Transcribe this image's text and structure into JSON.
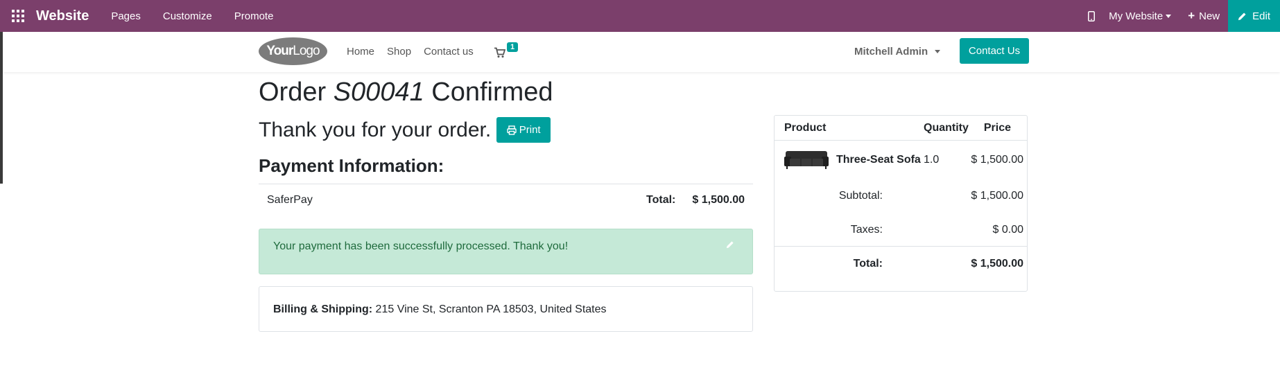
{
  "topbar": {
    "brand": "Website",
    "menu": [
      "Pages",
      "Customize",
      "Promote"
    ],
    "site_selector": "My Website",
    "new_label": "New",
    "edit_label": "Edit",
    "icons": [
      "apps-grid-icon",
      "mobile-icon",
      "plus-icon",
      "pencil-icon"
    ],
    "color": "#7b3f6b",
    "edit_color": "#00a09d"
  },
  "header": {
    "logo": {
      "bold": "Your",
      "rest": "Logo"
    },
    "nav": [
      "Home",
      "Shop",
      "Contact us"
    ],
    "cart_count": "1",
    "user": "Mitchell Admin",
    "contact_button": "Contact Us",
    "accent": "#00a09d"
  },
  "order": {
    "title_prefix": "Order",
    "order_number": "S00041",
    "title_suffix": "Confirmed",
    "thank_you": "Thank you for your order.",
    "print_label": "Print",
    "payment_heading": "Payment Information:",
    "payment_method": "SaferPay",
    "total_label": "Total:",
    "total_value": "$ 1,500.00",
    "alert_message": "Your payment has been successfully processed. Thank you!",
    "billing_label": "Billing & Shipping:",
    "billing_address": "215 Vine St, Scranton PA 18503, United States"
  },
  "summary": {
    "headers": {
      "product": "Product",
      "quantity": "Quantity",
      "price": "Price"
    },
    "line": {
      "name": "Three-Seat Sofa",
      "qty": "1.0",
      "price": "$ 1,500.00"
    },
    "subtotal_label": "Subtotal:",
    "subtotal_value": "$ 1,500.00",
    "taxes_label": "Taxes:",
    "taxes_value": "$ 0.00",
    "total_label": "Total:",
    "total_value": "$ 1,500.00"
  }
}
